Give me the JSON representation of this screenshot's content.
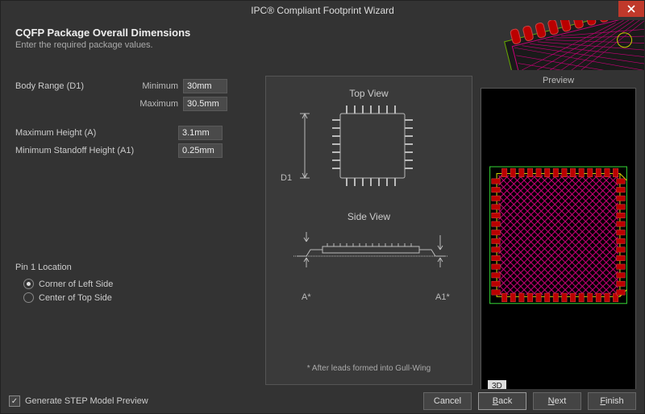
{
  "title": "IPC® Compliant Footprint Wizard",
  "header": {
    "heading": "CQFP Package Overall Dimensions",
    "sub": "Enter the required package values."
  },
  "left": {
    "body_range_label": "Body Range (D1)",
    "minimum_label": "Minimum",
    "maximum_label": "Maximum",
    "body_min": "30mm",
    "body_max": "30.5mm",
    "max_height_label": "Maximum Height (A)",
    "max_height": "3.1mm",
    "min_standoff_label": "Minimum Standoff Height (A1)",
    "min_standoff": "0.25mm",
    "pin1_title": "Pin 1 Location",
    "pin1_opt1": "Corner of Left Side",
    "pin1_opt2": "Center of Top Side"
  },
  "mid": {
    "top_view": "Top View",
    "side_view": "Side View",
    "d1": "D1",
    "a": "A*",
    "a1": "A1*",
    "note": "* After leads formed into Gull-Wing"
  },
  "preview": {
    "label": "Preview",
    "badge": "3D"
  },
  "footer": {
    "checkbox": "Generate STEP Model Preview",
    "cancel": "Cancel",
    "back": "ack",
    "back_u": "B",
    "next": "ext",
    "next_u": "N",
    "finish": "inish",
    "finish_u": "F"
  }
}
